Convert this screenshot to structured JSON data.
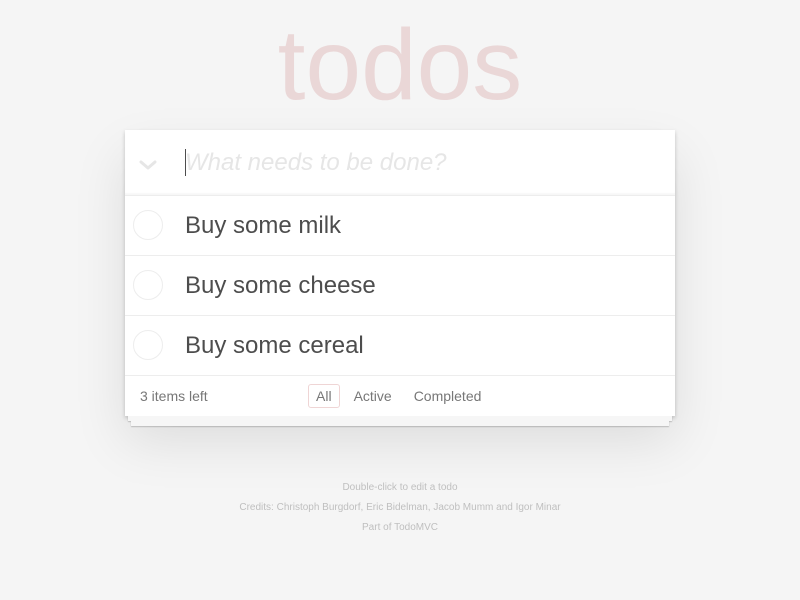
{
  "header": {
    "title": "todos",
    "new_todo_placeholder": "What needs to be done?",
    "new_todo_value": "",
    "toggle_all_icon": "chevron-down-icon"
  },
  "todos": [
    {
      "label": "Buy some milk",
      "completed": false
    },
    {
      "label": "Buy some cheese",
      "completed": false
    },
    {
      "label": "Buy some cereal",
      "completed": false
    }
  ],
  "footer": {
    "count_text": "3 items left",
    "filters": [
      {
        "label": "All",
        "selected": true
      },
      {
        "label": "Active",
        "selected": false
      },
      {
        "label": "Completed",
        "selected": false
      }
    ]
  },
  "info": {
    "edit_hint": "Double-click to edit a todo",
    "credits": "Credits: Christoph Burgdorf, Eric Bidelman, Jacob Mumm and Igor Minar",
    "part_of": "Part of TodoMVC"
  },
  "colors": {
    "background": "#f5f5f5",
    "title": "#eaddd7",
    "text": "#4d4d4d",
    "muted": "#777777",
    "selected_filter_border": "#efd5d5"
  }
}
